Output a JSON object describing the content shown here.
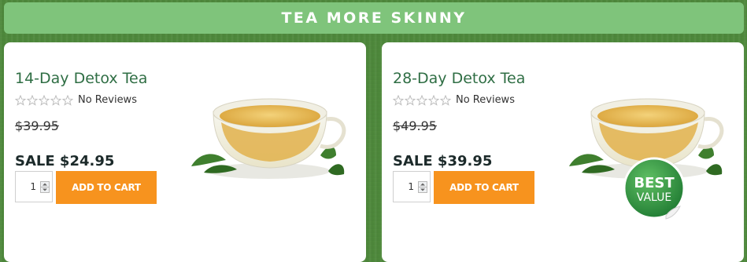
{
  "header": {
    "title": "TEA MORE SKINNY"
  },
  "products": [
    {
      "name": "14-Day Detox Tea",
      "reviews": "No Reviews",
      "original_price": "$39.95",
      "sale_price": "SALE $24.95",
      "quantity": "1",
      "button_label": "ADD TO CART",
      "rating": 0
    },
    {
      "name": "28-Day Detox Tea",
      "reviews": "No Reviews",
      "original_price": "$49.95",
      "sale_price": "SALE $39.95",
      "quantity": "1",
      "button_label": "ADD TO CART",
      "rating": 0,
      "badge": {
        "line1": "BEST",
        "line2": "VALUE"
      }
    }
  ],
  "colors": {
    "background": "#4f8a3c",
    "banner": "#7fc47b",
    "product_name": "#2f6e44",
    "button": "#f7931e",
    "badge": "#2e8b3e"
  },
  "icons": [
    "star-outline-icon",
    "spinner-up-icon",
    "spinner-down-icon",
    "best-value-badge-icon"
  ]
}
